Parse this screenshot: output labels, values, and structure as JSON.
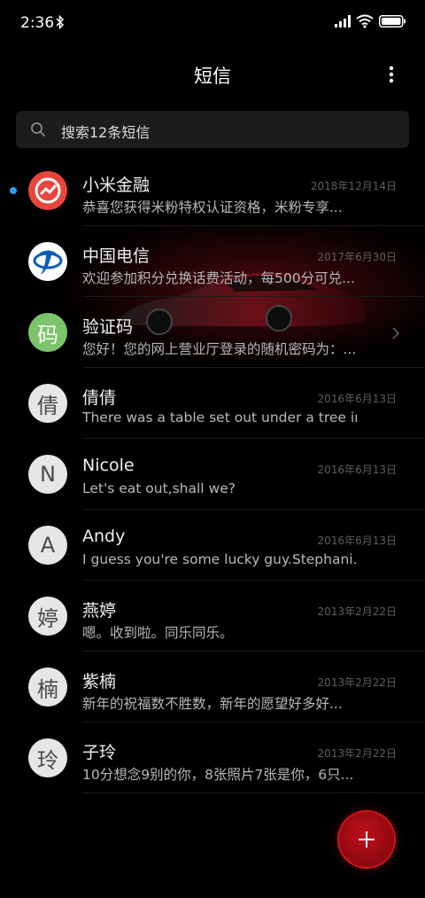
{
  "status_bar": {
    "time": "2:36"
  },
  "header": {
    "title": "短信"
  },
  "search": {
    "placeholder": "搜索12条短信"
  },
  "conversations": [
    {
      "name": "小米金融",
      "date": "2018年12月14日",
      "preview": "恭喜您获得米粉特权认证资格，米粉专享...",
      "avatar_type": "brand-mi-finance",
      "unread": true
    },
    {
      "name": "中国电信",
      "date": "2017年6月30日",
      "preview": "欢迎参加积分兑换话费活动，每500分可兑...",
      "avatar_type": "brand-china-telecom"
    },
    {
      "name": "验证码",
      "date": "",
      "preview": "您好！您的网上营业厅登录的随机密码为：...",
      "avatar_letter": "码",
      "avatar_color": "#7cc46b",
      "has_chevron": true
    },
    {
      "name": "倩倩",
      "date": "2016年6月13日",
      "preview": "There was a table set out under a tree in...",
      "avatar_letter": "倩"
    },
    {
      "name": "Nicole",
      "date": "2016年6月13日",
      "preview": "Let's eat out,shall we?",
      "avatar_letter": "N"
    },
    {
      "name": "Andy",
      "date": "2016年6月13日",
      "preview": "I guess you're some lucky guy.Stephani...",
      "avatar_letter": "A"
    },
    {
      "name": "燕婷",
      "date": "2013年2月22日",
      "preview": "嗯。收到啦。同乐同乐。",
      "avatar_letter": "婷"
    },
    {
      "name": "紫楠",
      "date": "2013年2月22日",
      "preview": "新年的祝福数不胜数，新年的愿望好多好...",
      "avatar_letter": "楠"
    },
    {
      "name": "子玲",
      "date": "2013年2月22日",
      "preview": "10分想念9别的你，8张照片7张是你，6只...",
      "avatar_letter": "玲"
    }
  ],
  "fab": {
    "icon": "plus-icon"
  },
  "colors": {
    "background": "#000000",
    "unread_dot": "#2e9bf0",
    "fab": "#c0101a"
  }
}
